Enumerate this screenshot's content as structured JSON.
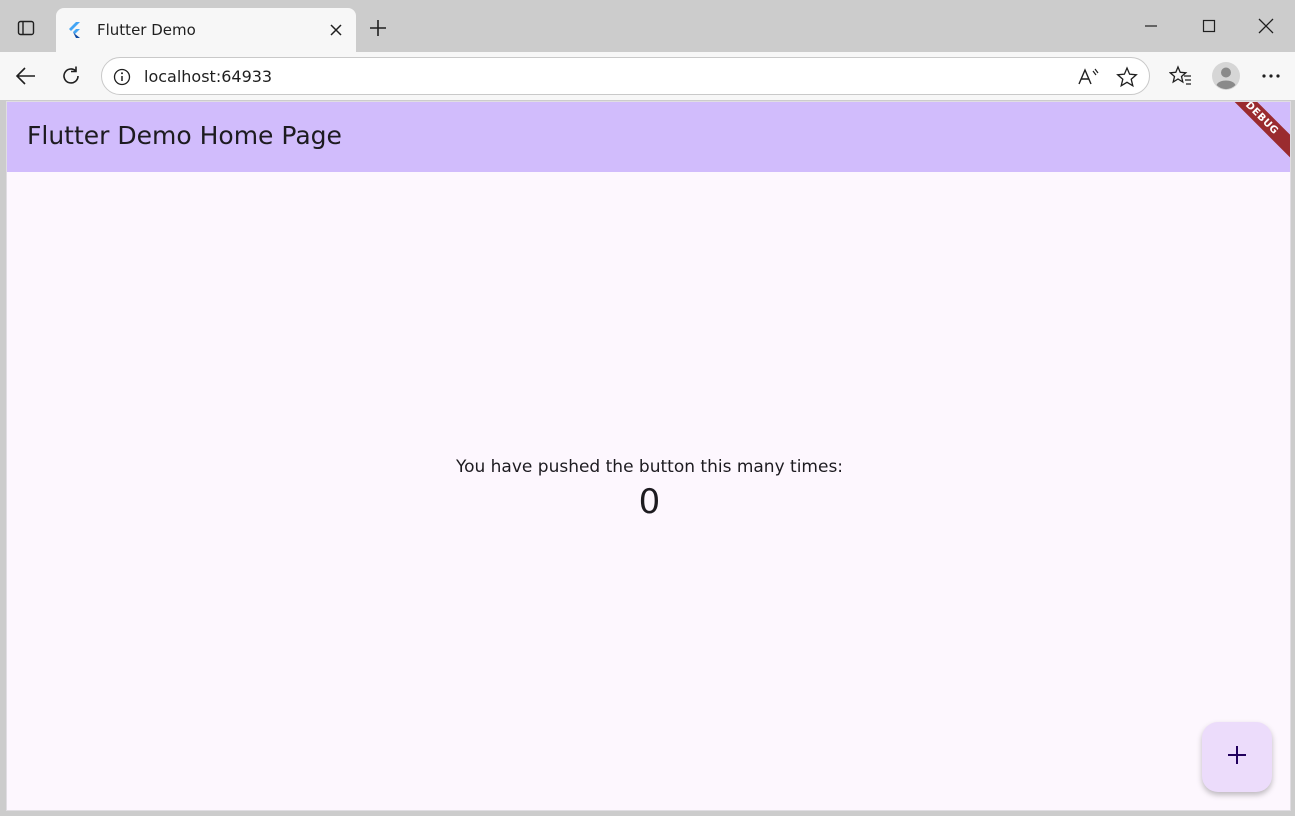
{
  "browser": {
    "tab": {
      "title": "Flutter Demo"
    },
    "address_bar": {
      "url": "localhost:64933"
    },
    "icons": {
      "tab_actions": "tab-actions-icon",
      "favicon": "flutter-logo-icon",
      "close_tab": "close-icon",
      "new_tab": "plus-icon",
      "minimize": "minimize-icon",
      "maximize": "maximize-icon",
      "close_window": "close-icon",
      "back": "back-arrow-icon",
      "refresh": "refresh-icon",
      "info": "info-icon",
      "read_aloud": "read-aloud-icon",
      "favorite": "star-icon",
      "favorites": "favorites-icon",
      "profile": "avatar-icon",
      "more": "more-icon"
    }
  },
  "app": {
    "title": "Flutter Demo Home Page",
    "debug_banner": "DEBUG",
    "counter_label": "You have pushed the button this many times:",
    "counter_value": "0",
    "fab_icon": "plus-icon",
    "colors": {
      "appbar": "#d1bcfc",
      "background": "#fdf7fe",
      "fab": "#ecdcfb",
      "debug_ribbon": "#9a2b2f"
    }
  }
}
